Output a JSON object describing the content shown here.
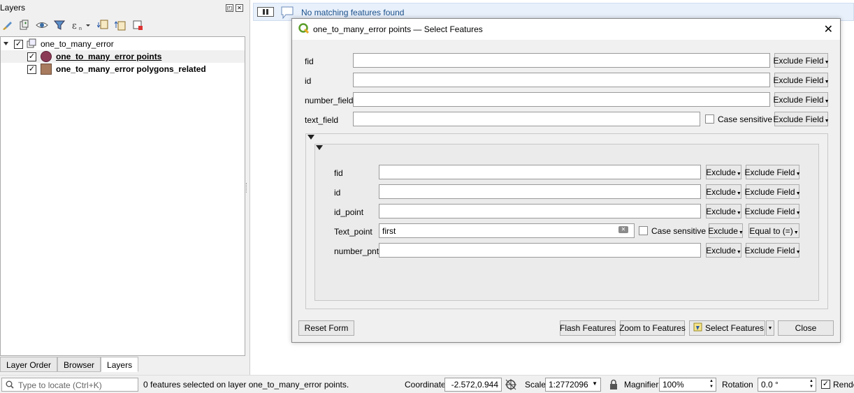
{
  "layers_panel": {
    "title": "Layers",
    "float_btn": "◰",
    "close_btn": "✕",
    "toolbar_icons": [
      "paint-brush-icon",
      "add-group-icon",
      "eye-icon",
      "filter-icon",
      "expression-filter-icon",
      "expand-all-icon",
      "collapse-all-icon",
      "remove-layer-icon"
    ],
    "group_name": "one_to_many_error",
    "layers": [
      {
        "name": "one_to_many_error points",
        "symbol": "circle",
        "color": "#8b3a55",
        "checked": "✓"
      },
      {
        "name": "one_to_many_error polygons_related",
        "symbol": "square",
        "color": "#a87b5e",
        "checked": "✓"
      }
    ],
    "group_checked": "✓",
    "tabs": [
      "Layer Order",
      "Browser",
      "Layers"
    ]
  },
  "message_bar": {
    "text": "No matching features found"
  },
  "dialog": {
    "title": "one_to_many_error points — Select Features",
    "close": "✕",
    "fields": [
      {
        "label": "fid",
        "value": "",
        "button": "Exclude Field"
      },
      {
        "label": "id",
        "value": "",
        "button": "Exclude Field"
      },
      {
        "label": "number_field",
        "value": "",
        "button": "Exclude Field"
      },
      {
        "label": "text_field",
        "value": "",
        "case_label": "Case sensitive",
        "button": "Exclude Field"
      }
    ],
    "related_fields": [
      {
        "label": "fid",
        "value": "",
        "exclude": "Exclude",
        "button": "Exclude Field"
      },
      {
        "label": "id",
        "value": "",
        "exclude": "Exclude",
        "button": "Exclude Field"
      },
      {
        "label": "id_point",
        "value": "",
        "exclude": "Exclude",
        "button": "Exclude Field"
      },
      {
        "label": "Text_point",
        "value": "first",
        "case_label": "Case sensitive",
        "exclude": "Exclude",
        "button": "Equal to (=)"
      },
      {
        "label": "number_pnt",
        "value": "",
        "exclude": "Exclude",
        "button": "Exclude Field"
      }
    ],
    "buttons": {
      "reset": "Reset Form",
      "flash": "Flash Features",
      "zoom": "Zoom to Features",
      "select": "Select Features",
      "close": "Close"
    }
  },
  "status_bar": {
    "locate_placeholder": "Type to locate (Ctrl+K)",
    "message": "0 features selected on layer one_to_many_error points.",
    "coordinate_label": "Coordinate",
    "coordinate_value": "-2.572,0.944",
    "scale_label": "Scale",
    "scale_value": "1:2772096",
    "magnifier_label": "Magnifier",
    "magnifier_value": "100%",
    "rotation_label": "Rotation",
    "rotation_value": "0.0 °",
    "render_label": "Rende",
    "render_checked": "✓"
  }
}
